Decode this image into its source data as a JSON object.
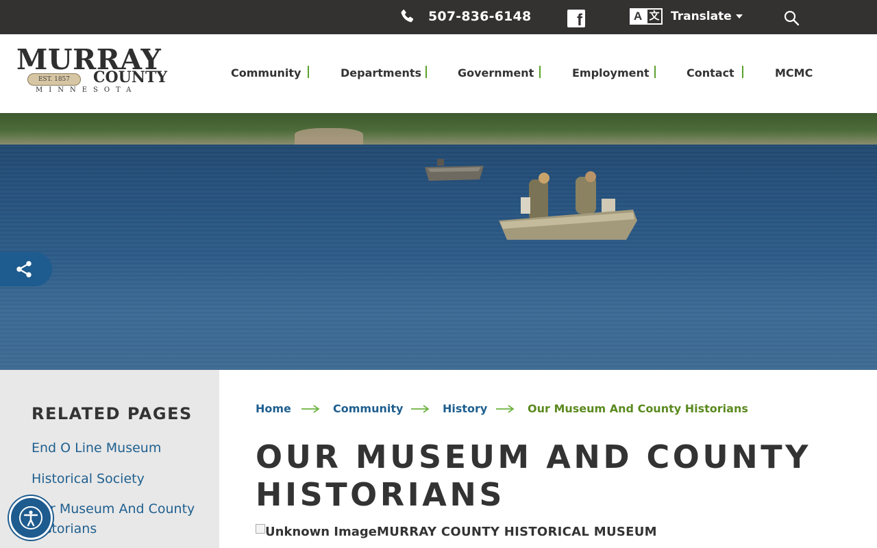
{
  "topbar": {
    "phone": "507-836-6148",
    "phone_icon": "phone-icon",
    "facebook_icon": "facebook-icon",
    "translate_label": "Translate",
    "translate_icon": "translate-icon",
    "search_icon": "search-icon"
  },
  "logo": {
    "line1": "MURRAY",
    "est": "EST. 1857",
    "line2": "COUNTY",
    "line3": "MINNESOTA"
  },
  "nav": {
    "items": [
      {
        "label": "Community"
      },
      {
        "label": "Departments"
      },
      {
        "label": "Government"
      },
      {
        "label": "Employment"
      },
      {
        "label": "Contact"
      },
      {
        "label": "MCMC"
      }
    ]
  },
  "sidebar": {
    "title": "RELATED PAGES",
    "links": [
      {
        "label": "End O Line Museum"
      },
      {
        "label": "Historical Society"
      },
      {
        "label": "Our Museum And County Historians"
      }
    ]
  },
  "breadcrumb": {
    "items": [
      {
        "label": "Home"
      },
      {
        "label": "Community"
      },
      {
        "label": "History"
      }
    ],
    "current": "Our Museum And County Historians"
  },
  "main": {
    "title": "OUR MUSEUM AND COUNTY HISTORIANS",
    "image_alt": "Unknown Image",
    "image_caption": "MURRAY COUNTY HISTORICAL MUSEUM"
  },
  "colors": {
    "topbar_bg": "#343131",
    "accent_green": "#5aa02c",
    "link_blue": "#1f5f8f",
    "sidebar_bg": "#e8e8e8"
  }
}
